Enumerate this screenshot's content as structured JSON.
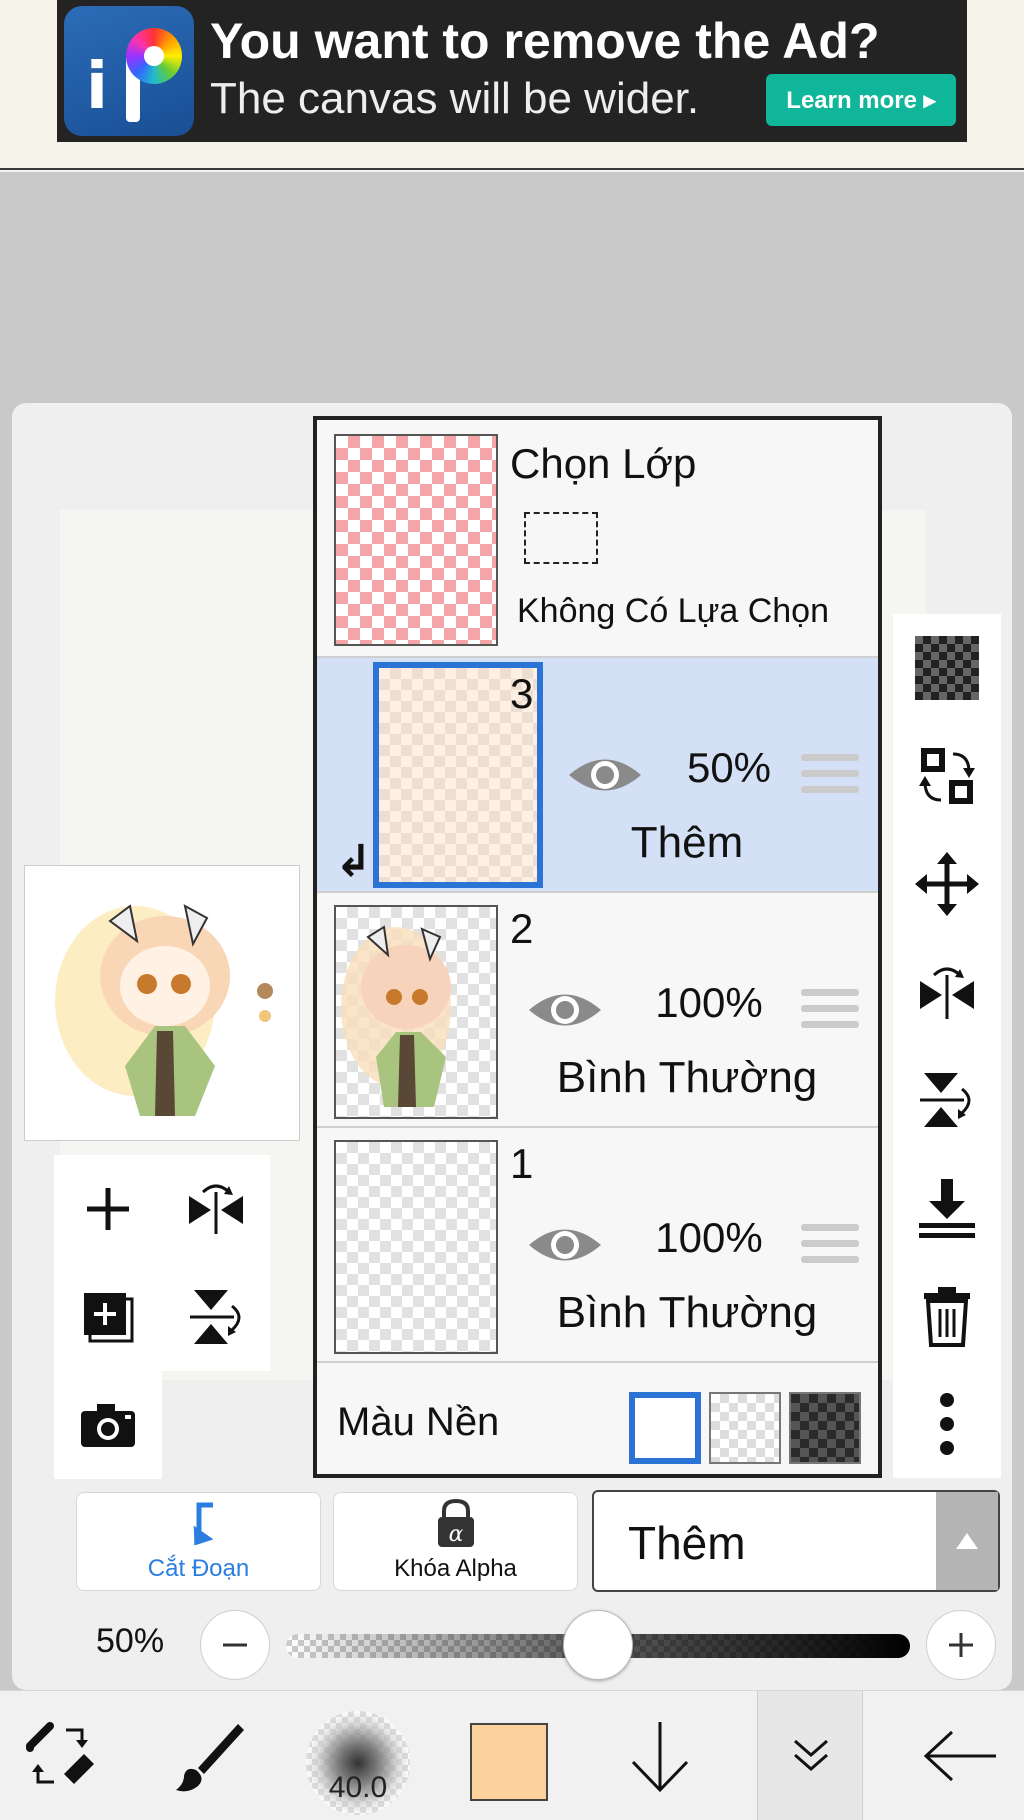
{
  "ad": {
    "title": "You want to remove the Ad?",
    "subtitle": "The canvas will be wider.",
    "cta": "Learn more ▸",
    "logo_icon": "ibispaint-logo"
  },
  "layers_panel": {
    "selection_layer": {
      "title": "Chọn Lớp",
      "status": "Không Có Lựa Chọn"
    },
    "layers": [
      {
        "number": "3",
        "opacity": "50%",
        "blend_mode": "Thêm",
        "active": true,
        "clipped": true
      },
      {
        "number": "2",
        "opacity": "100%",
        "blend_mode": "Bình Thường",
        "active": false,
        "clipped": false
      },
      {
        "number": "1",
        "opacity": "100%",
        "blend_mode": "Bình Thường",
        "active": false,
        "clipped": false
      }
    ],
    "background": {
      "label": "Màu Nền",
      "options": [
        "white",
        "transparent",
        "dark-checker"
      ],
      "selected": "white"
    }
  },
  "controls": {
    "clipping_label": "Cắt Đoạn",
    "alpha_lock_label": "Khóa Alpha",
    "blend_mode_value": "Thêm",
    "opacity_label": "50%",
    "opacity_value": 0.5
  },
  "bottom_bar": {
    "brush_size": "40.0",
    "current_color": "#fdd19c"
  },
  "colors": {
    "accent_blue": "#2b74d6",
    "active_row": "#d3e0f5",
    "ad_button": "#10b69a"
  }
}
